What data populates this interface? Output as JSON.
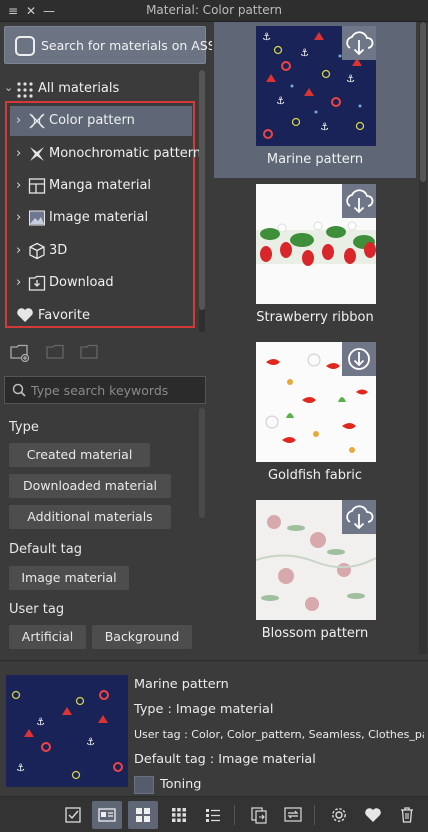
{
  "window": {
    "title": "Material: Color pattern"
  },
  "assets_button": {
    "label": "Search for materials on ASSETS"
  },
  "tree": {
    "root_label": "All materials",
    "items": [
      {
        "label": "Color pattern",
        "icon": "color-pattern-icon",
        "selected": true
      },
      {
        "label": "Monochromatic pattern",
        "icon": "mono-pattern-icon"
      },
      {
        "label": "Manga material",
        "icon": "manga-icon"
      },
      {
        "label": "Image material",
        "icon": "image-icon"
      },
      {
        "label": "3D",
        "icon": "cube-icon"
      },
      {
        "label": "Download",
        "icon": "download-folder-icon"
      }
    ],
    "favorite_label": "Favorite"
  },
  "search": {
    "placeholder": "Type search keywords",
    "value": ""
  },
  "filters": {
    "type_label": "Type",
    "type_tags": [
      "Created material",
      "Downloaded material",
      "Additional materials"
    ],
    "default_tag_label": "Default tag",
    "default_tags": [
      "Image material"
    ],
    "user_tag_label": "User tag",
    "user_tags": [
      "Artificial",
      "Background"
    ]
  },
  "materials": [
    {
      "name": "Marine pattern",
      "selected": true
    },
    {
      "name": "Strawberry ribbon"
    },
    {
      "name": "Goldfish fabric"
    },
    {
      "name": "Blossom pattern"
    }
  ],
  "details": {
    "name": "Marine pattern",
    "type": "Type : Image material",
    "user_tag": "User tag : Color, Color_pattern, Seamless, Clothes_pattern, Pattern",
    "default_tag": "Default tag : Image material",
    "toning": "Toning"
  },
  "colors": {
    "selection": "#5f6776",
    "highlight_border": "#d43a3a",
    "marine_bg": "#1a2357"
  }
}
